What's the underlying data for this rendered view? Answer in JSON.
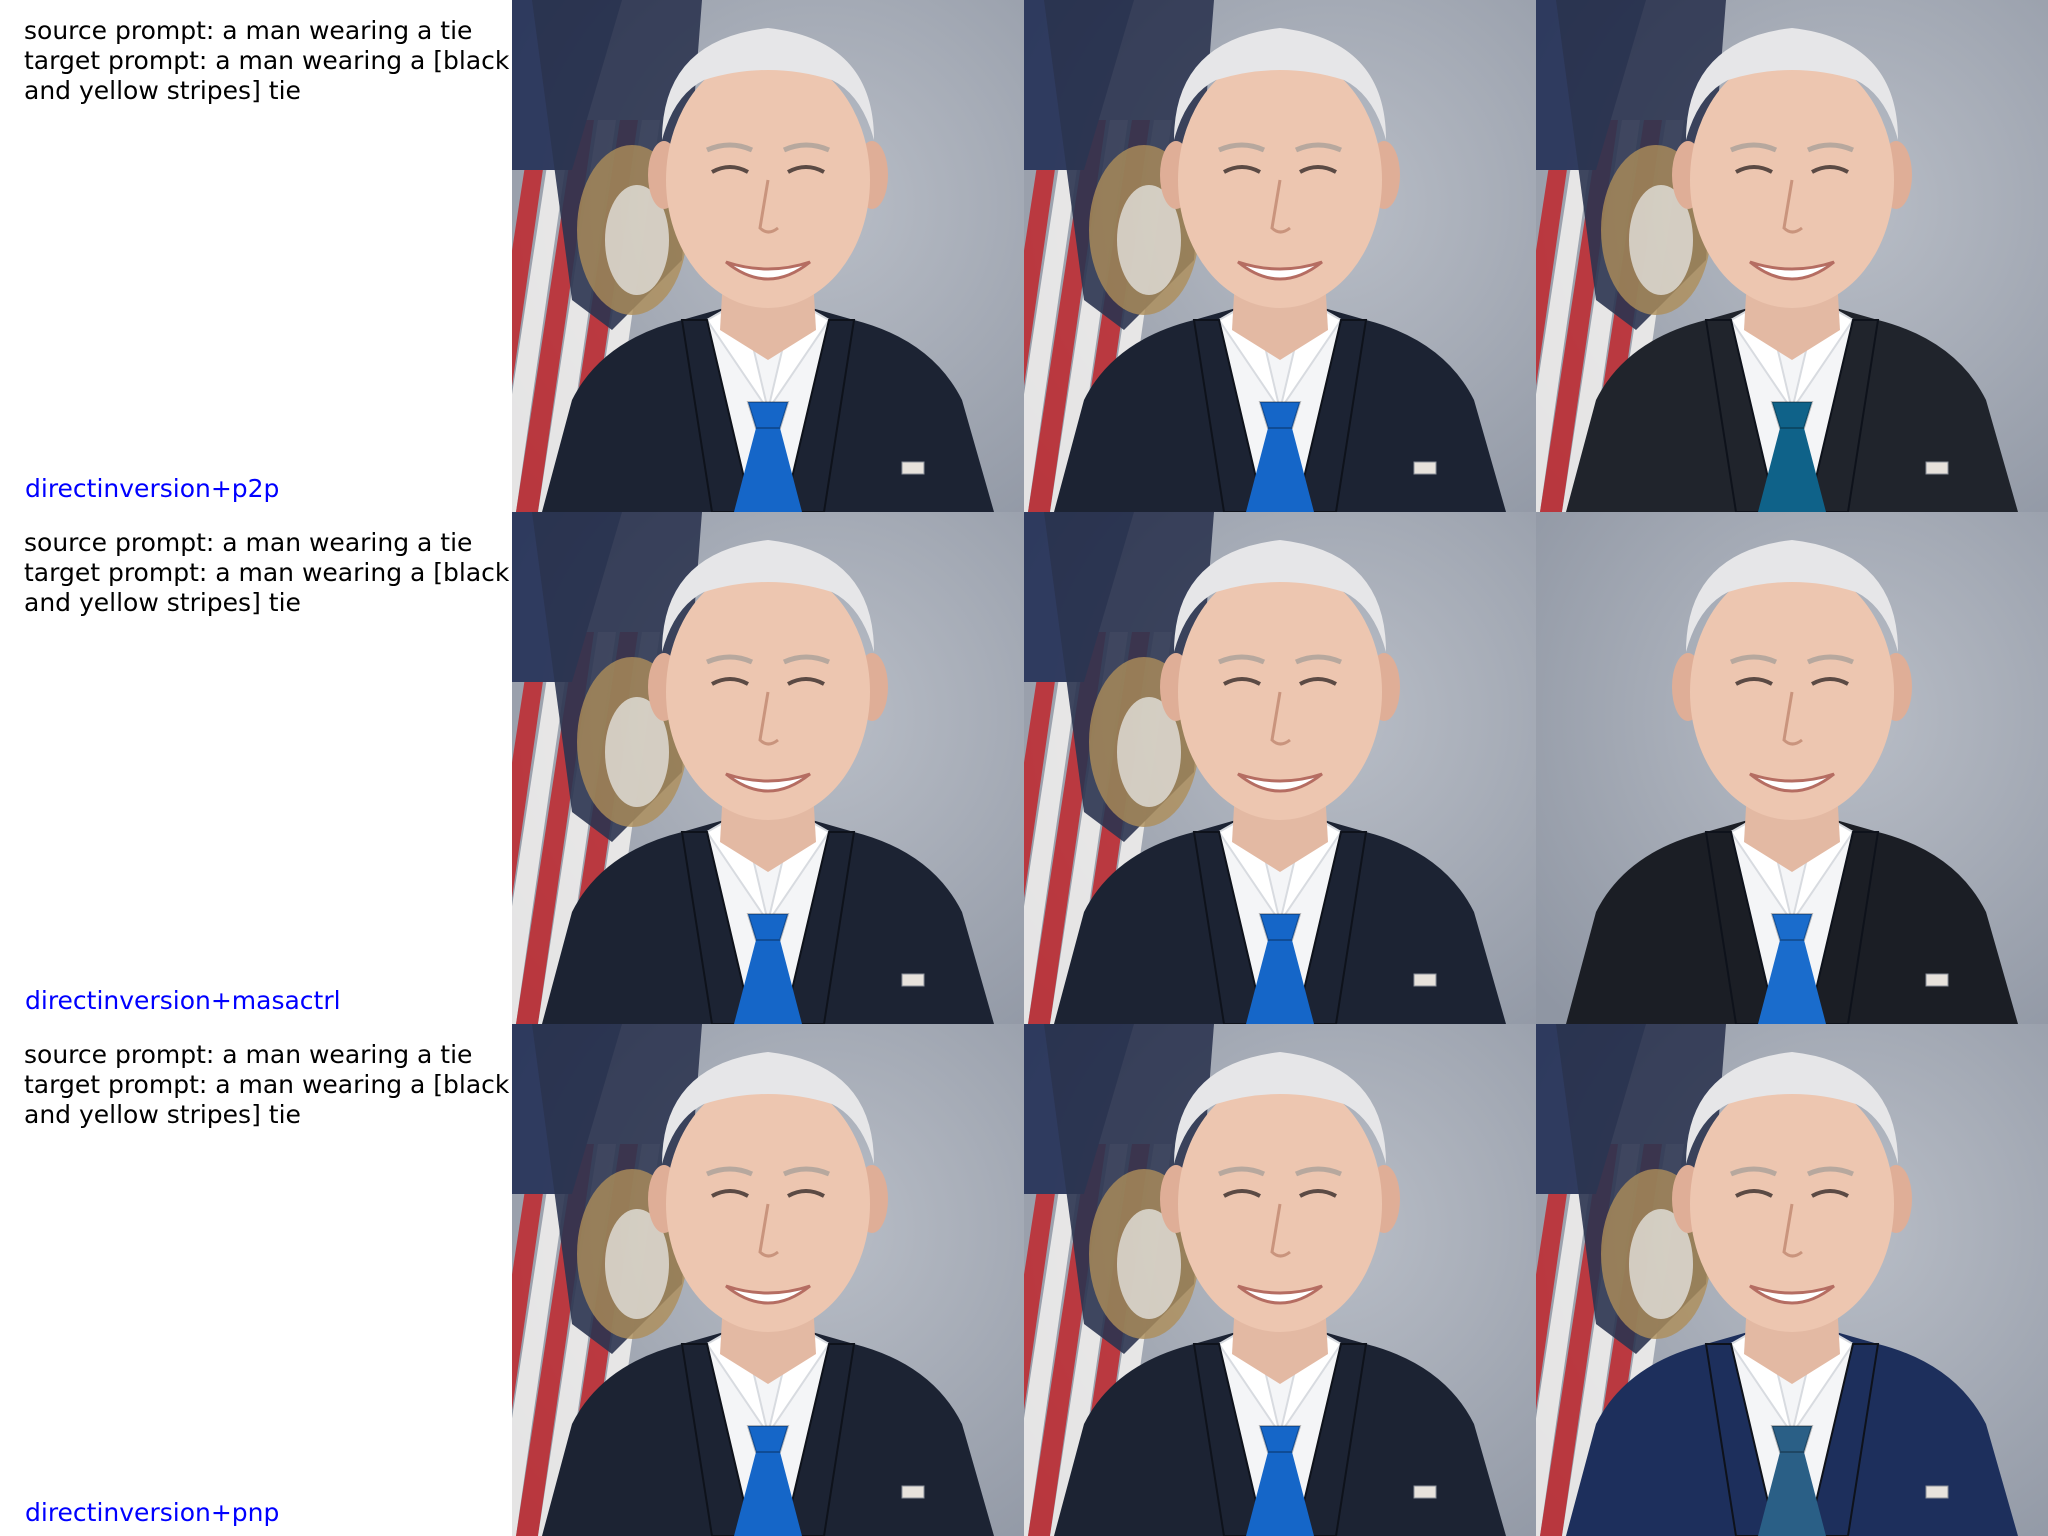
{
  "colors": {
    "method_label": "#0000ff",
    "caption_text": "#000000",
    "background": "#ffffff"
  },
  "rows": [
    {
      "source_prompt_line": "source prompt: a man wearing a tie",
      "target_prompt_line1": "target prompt: a man wearing a [black",
      "target_prompt_line2": "and yellow stripes] tie",
      "method": "directinversion+p2p",
      "tie_colors": [
        "#1566c8",
        "#1566c8",
        "#0f6289"
      ],
      "suit_colors": [
        "#1c2333",
        "#1c2333",
        "#20242c"
      ],
      "flag_visible": [
        true,
        true,
        true
      ]
    },
    {
      "source_prompt_line": "source prompt: a man wearing a tie",
      "target_prompt_line1": "target prompt: a man wearing a [black",
      "target_prompt_line2": "and yellow stripes] tie",
      "method": "directinversion+masactrl",
      "tie_colors": [
        "#1566c8",
        "#1566c8",
        "#1a6ccc"
      ],
      "suit_colors": [
        "#1c2333",
        "#1c2333",
        "#1b1e25"
      ],
      "flag_visible": [
        true,
        true,
        false
      ]
    },
    {
      "source_prompt_line": "source prompt: a man wearing a tie",
      "target_prompt_line1": "target prompt: a man wearing a [black",
      "target_prompt_line2": "and yellow stripes] tie",
      "method": "directinversion+pnp",
      "tie_colors": [
        "#1566c8",
        "#1566c8",
        "#2a5f86"
      ],
      "suit_colors": [
        "#1c2333",
        "#1c2333",
        "#1d2f5c"
      ],
      "flag_visible": [
        true,
        true,
        true
      ]
    }
  ]
}
